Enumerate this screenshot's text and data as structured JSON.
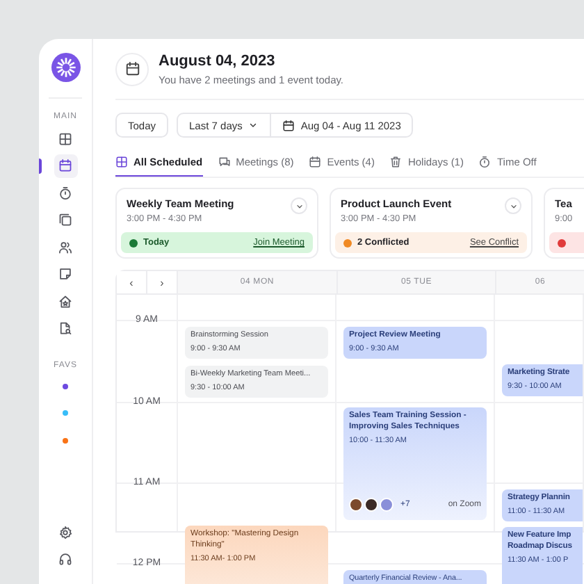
{
  "sidebar": {
    "main_label": "MAIN",
    "items": [
      {
        "selected": false
      },
      {
        "selected": true
      },
      {
        "selected": false
      },
      {
        "selected": false
      },
      {
        "selected": false
      },
      {
        "selected": false
      },
      {
        "selected": false
      },
      {
        "selected": false
      }
    ],
    "favs_label": "FAVS",
    "favs": [
      {
        "color": "#6d4ae0"
      },
      {
        "color": "#38bdf8"
      },
      {
        "color": "#f97316"
      }
    ],
    "bottom": [
      {
        "kind": "settings"
      },
      {
        "kind": "support"
      }
    ]
  },
  "header": {
    "title": "August 04, 2023",
    "subtitle": "You have 2 meetings and 1 event today."
  },
  "toolbar": {
    "today": "Today",
    "range_select": "Last 7 days",
    "date_range": "Aug 04 - Aug 11 2023"
  },
  "tabs": [
    {
      "label": "All Scheduled",
      "selected": true
    },
    {
      "label": "Meetings (8)",
      "selected": false
    },
    {
      "label": "Events (4)",
      "selected": false
    },
    {
      "label": "Holidays (1)",
      "selected": false
    },
    {
      "label": "Time Off",
      "selected": false
    }
  ],
  "cards": [
    {
      "title": "Weekly Team Meeting",
      "time": "3:00 PM - 4:30 PM",
      "status": {
        "kind": "today",
        "label": "Today",
        "action": "Join Meeting"
      }
    },
    {
      "title": "Product Launch Event",
      "time": "3:00 PM - 4:30 PM",
      "status": {
        "kind": "conflict",
        "label": "2 Conflicted",
        "action": "See Conflict"
      }
    },
    {
      "title": "Tea",
      "time": "9:00",
      "status": {
        "kind": "declined"
      }
    }
  ],
  "calendar": {
    "nav": [
      "‹",
      "›"
    ],
    "hours": [
      "9 AM",
      "10 AM",
      "11 AM",
      "12 PM"
    ],
    "days": [
      {
        "label": "04 MON",
        "events": [
          {
            "kind": "plain",
            "title": "Brainstorming Session",
            "time": "9:00 - 9:30 AM"
          },
          {
            "kind": "plain",
            "title": "Bi-Weekly Marketing Team Meeti...",
            "time": "9:30 - 10:00 AM"
          },
          {
            "kind": "workshop",
            "title": "Workshop: \"Mastering Design Thinking\"",
            "time": "11:30 AM- 1:00 PM"
          }
        ]
      },
      {
        "label": "05 TUE",
        "events": [
          {
            "kind": "meeting",
            "title": "Project Review Meeting",
            "time": "9:00 - 9:30 AM"
          },
          {
            "kind": "training",
            "title": "Sales Team Training Session - Improving Sales Techniques",
            "time": "10:00 - 11:30 AM",
            "avatars": [
              {
                "color": "#7c4a2d"
              },
              {
                "color": "#3b2a26"
              },
              {
                "color": "#8a8fd9"
              }
            ],
            "more": "+7",
            "location": "on Zoom"
          },
          {
            "kind": "meeting",
            "title": "Quarterly Financial Review - Ana..."
          }
        ]
      },
      {
        "label": "06",
        "events": [
          {
            "kind": "meeting",
            "title": "Marketing Strate",
            "time": "9:30 - 10:00 AM"
          },
          {
            "kind": "meeting",
            "title": "Strategy Plannin",
            "time": "11:00 - 11:30 AM"
          },
          {
            "kind": "meeting",
            "title": "New Feature Imp Roadmap Discus",
            "time": "11:30 AM - 1:00 P"
          }
        ]
      }
    ]
  }
}
